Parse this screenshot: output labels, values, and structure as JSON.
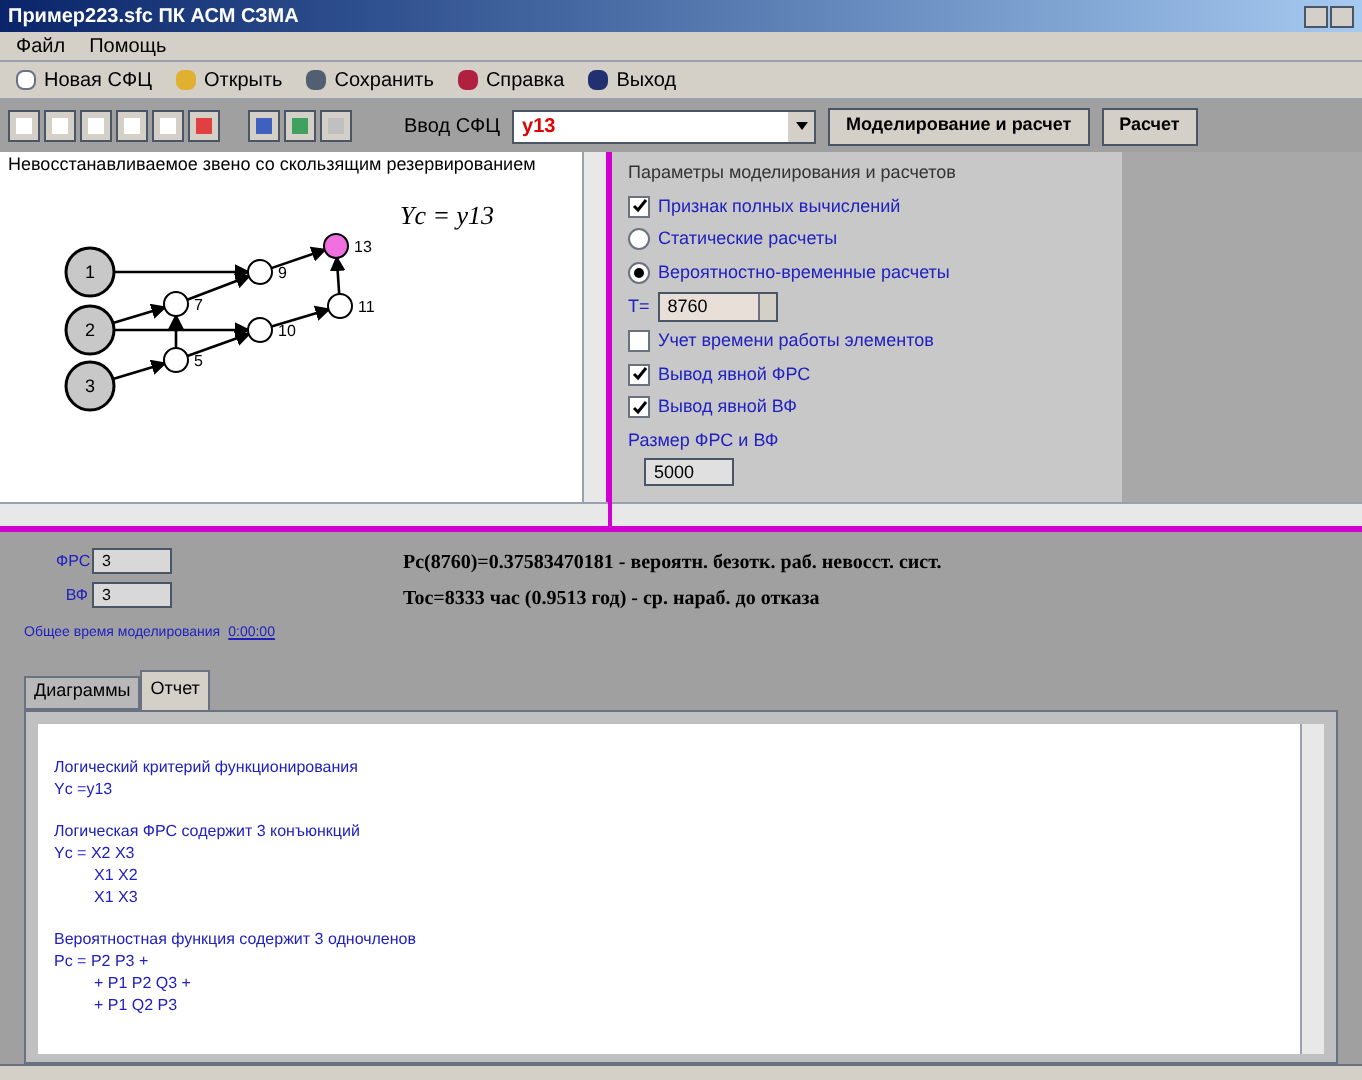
{
  "window": {
    "title": "Пример223.sfc  ПК АСМ СЗМА"
  },
  "menu": [
    "Файл",
    "Помощь"
  ],
  "toolbar": [
    "Новая СФЦ",
    "Открыть",
    "Сохранить",
    "Справка",
    "Выход"
  ],
  "input": {
    "label": "Ввод СФЦ",
    "value": "y13"
  },
  "action_buttons": [
    "Моделирование и расчет",
    "Расчет"
  ],
  "scheme": {
    "title": "Невосстанавливаемое звено со скользящим резервированием",
    "formula": "Yc = y13",
    "nodes": [
      {
        "label": "1",
        "kind": "input"
      },
      {
        "label": "2",
        "kind": "input"
      },
      {
        "label": "3",
        "kind": "input"
      },
      {
        "label": "7",
        "kind": "gate"
      },
      {
        "label": "5",
        "kind": "gate"
      },
      {
        "label": "9",
        "kind": "gate"
      },
      {
        "label": "10",
        "kind": "gate"
      },
      {
        "label": "11",
        "kind": "gate"
      },
      {
        "label": "13",
        "kind": "output"
      }
    ]
  },
  "params": {
    "title": "Параметры моделирования и расчетов",
    "items": [
      {
        "kind": "checkbox",
        "label": "Признак полных вычислений",
        "checked": true
      },
      {
        "kind": "radio",
        "label": "Статические расчеты",
        "selected": false
      },
      {
        "kind": "radio",
        "label": "Вероятностно-временные расчеты",
        "selected": true
      },
      {
        "kind": "spin",
        "label": "T=",
        "value": "8760"
      },
      {
        "kind": "checkbox",
        "label": "Учет времени работы элементов",
        "checked": false
      },
      {
        "kind": "checkbox",
        "label": "Вывод явной ФРС",
        "checked": true
      },
      {
        "kind": "checkbox",
        "label": "Вывод явной ВФ",
        "checked": true
      },
      {
        "kind": "field",
        "label": "Размер ФРС и ВФ",
        "value": "5000"
      }
    ]
  },
  "counts": [
    {
      "label": "ФРС",
      "value": "3"
    },
    {
      "label": "ВФ",
      "value": "3"
    }
  ],
  "time": {
    "label": "Общее время моделирования",
    "value": "0:00:00"
  },
  "results": [
    "Pc(8760)=0.37583470181 - вероятн. безотк. раб. невосст. сист.",
    "Toc=8333 час (0.9513 год) - ср. нараб. до отказа"
  ],
  "tabs": [
    {
      "label": "Диаграммы",
      "selected": false
    },
    {
      "label": "Отчет",
      "selected": true
    }
  ],
  "report": [
    {
      "heading": "Логический критерий функционирования",
      "lines": [
        {
          "text": "Yc =y13"
        }
      ]
    },
    {
      "heading": "Логическая ФРС содержит 3 конъюнкций",
      "lines": [
        {
          "text": "Yc = X2 X3",
          "children": [
            {
              "text": "X1 X2"
            },
            {
              "text": "X1 X3"
            }
          ]
        }
      ]
    },
    {
      "heading": "Вероятностная функция содержит 3 одночленов",
      "lines": [
        {
          "text": "Pc = P2 P3 +",
          "children": [
            {
              "text": "+ P1 P2 Q3 +"
            },
            {
              "text": "+ P1 Q2 P3"
            }
          ]
        }
      ]
    }
  ]
}
